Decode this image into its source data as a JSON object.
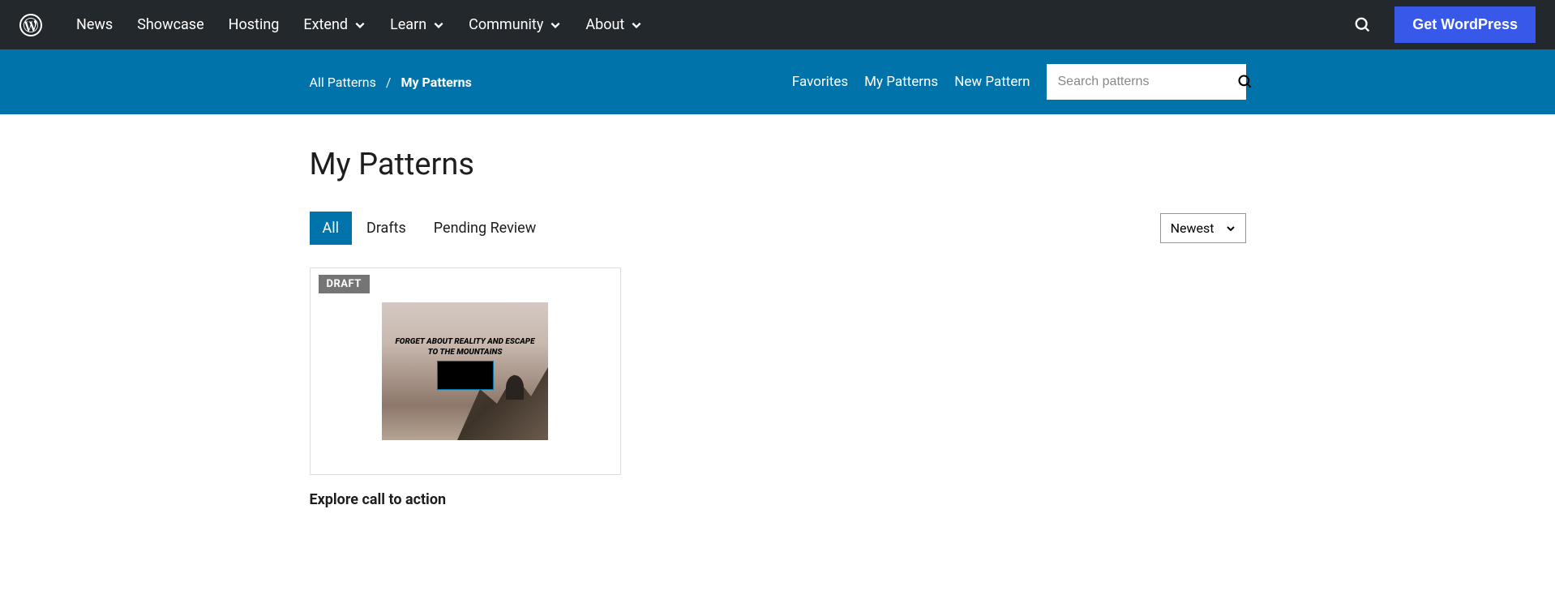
{
  "nav": {
    "items": [
      "News",
      "Showcase",
      "Hosting",
      "Extend",
      "Learn",
      "Community",
      "About"
    ],
    "dropdown": [
      false,
      false,
      false,
      true,
      true,
      true,
      true
    ],
    "cta": "Get WordPress"
  },
  "subnav": {
    "breadcrumb": {
      "root": "All Patterns",
      "sep": "/",
      "current": "My Patterns"
    },
    "links": [
      "Favorites",
      "My Patterns",
      "New Pattern"
    ],
    "search_placeholder": "Search patterns"
  },
  "page": {
    "title": "My Patterns",
    "tabs": [
      "All",
      "Drafts",
      "Pending Review"
    ],
    "active_tab": 0,
    "sort": "Newest"
  },
  "patterns": [
    {
      "status": "DRAFT",
      "title": "Explore call to action",
      "preview_heading": "FORGET ABOUT REALITY AND ESCAPE TO THE MOUNTAINS"
    }
  ]
}
